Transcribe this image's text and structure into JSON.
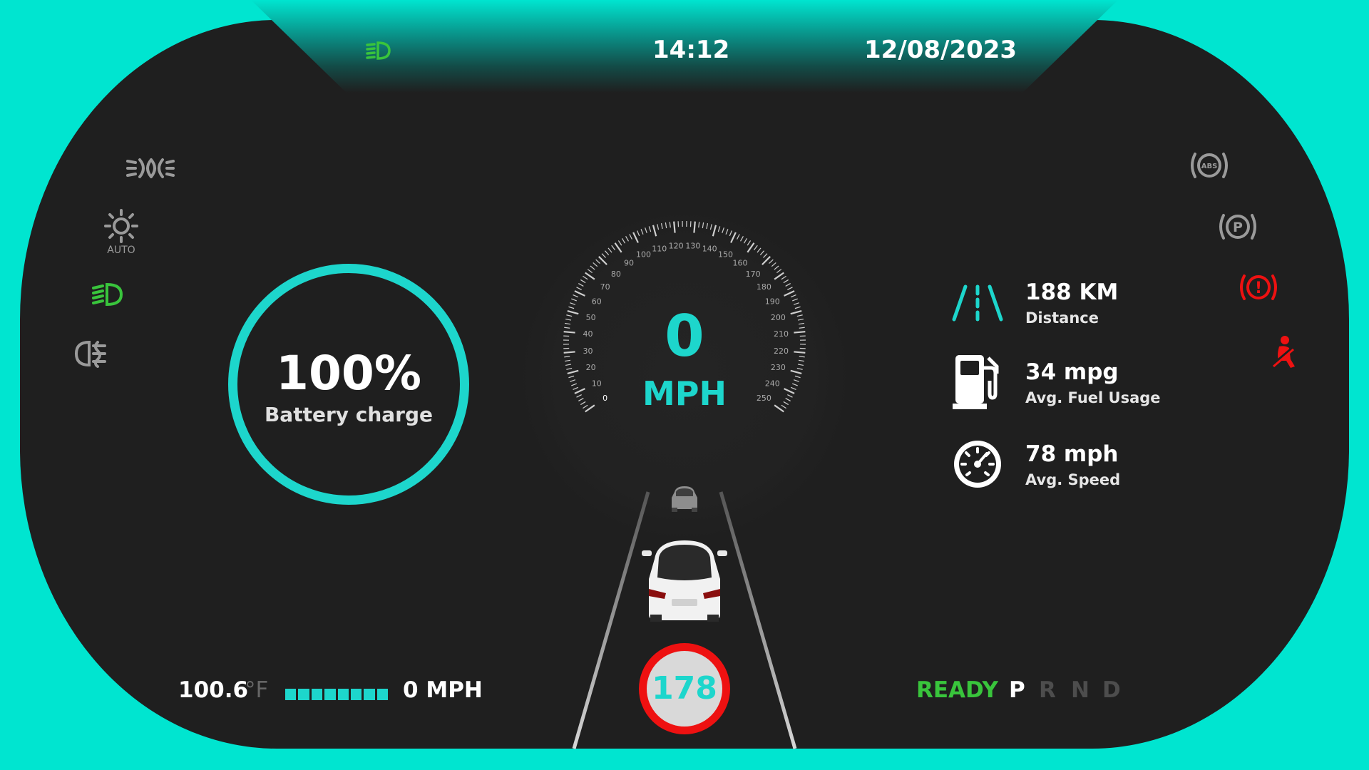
{
  "header": {
    "time": "14:12",
    "date": "12/08/2023",
    "headlight_indicator_icon": "headlight-icon"
  },
  "left_indicators": [
    {
      "name": "parking-lights-icon",
      "color": "#9a9a9a"
    },
    {
      "name": "auto-headlights-icon",
      "label": "AUTO",
      "color": "#9a9a9a"
    },
    {
      "name": "low-beam-icon",
      "color": "#39c43c"
    },
    {
      "name": "rear-fog-light-icon",
      "color": "#9a9a9a"
    }
  ],
  "right_indicators": [
    {
      "name": "abs-warning-icon",
      "label": "ABS",
      "color": "#9a9a9a"
    },
    {
      "name": "parking-brake-icon",
      "label": "P",
      "color": "#9a9a9a"
    },
    {
      "name": "brake-warning-icon",
      "label": "!",
      "color": "#ee1111"
    },
    {
      "name": "seatbelt-warning-icon",
      "color": "#ee1111"
    }
  ],
  "battery": {
    "percent": "100%",
    "label": "Battery charge",
    "ring_color": "#1dd6cc"
  },
  "speedometer": {
    "value": "0",
    "unit": "MPH",
    "tick_labels": [
      "0",
      "10",
      "20",
      "30",
      "40",
      "50",
      "60",
      "70",
      "80",
      "90",
      "100",
      "110",
      "120",
      "130",
      "140",
      "150",
      "160",
      "170",
      "180",
      "190",
      "200",
      "210",
      "220",
      "230",
      "240",
      "250"
    ]
  },
  "stats": [
    {
      "icon": "road-icon",
      "value": "188 KM",
      "label": "Distance"
    },
    {
      "icon": "fuel-pump-icon",
      "value": "34 mpg",
      "label": "Avg. Fuel Usage"
    },
    {
      "icon": "speedometer-icon",
      "value": "78 mph",
      "label": "Avg. Speed"
    }
  ],
  "bottom": {
    "temperature": "100.6",
    "temperature_unit": "°F",
    "temperature_bar_segments": 8,
    "speed_text": "0 MPH",
    "speed_limit": "178",
    "status": "READY",
    "status_color": "#39c43c",
    "gears": [
      "P",
      "R",
      "N",
      "D"
    ],
    "selected_gear": "P"
  },
  "colors": {
    "accent": "#00e5d0",
    "background": "#1f1f1f",
    "active_indicator": "#39c43c",
    "warning": "#ee1111"
  }
}
